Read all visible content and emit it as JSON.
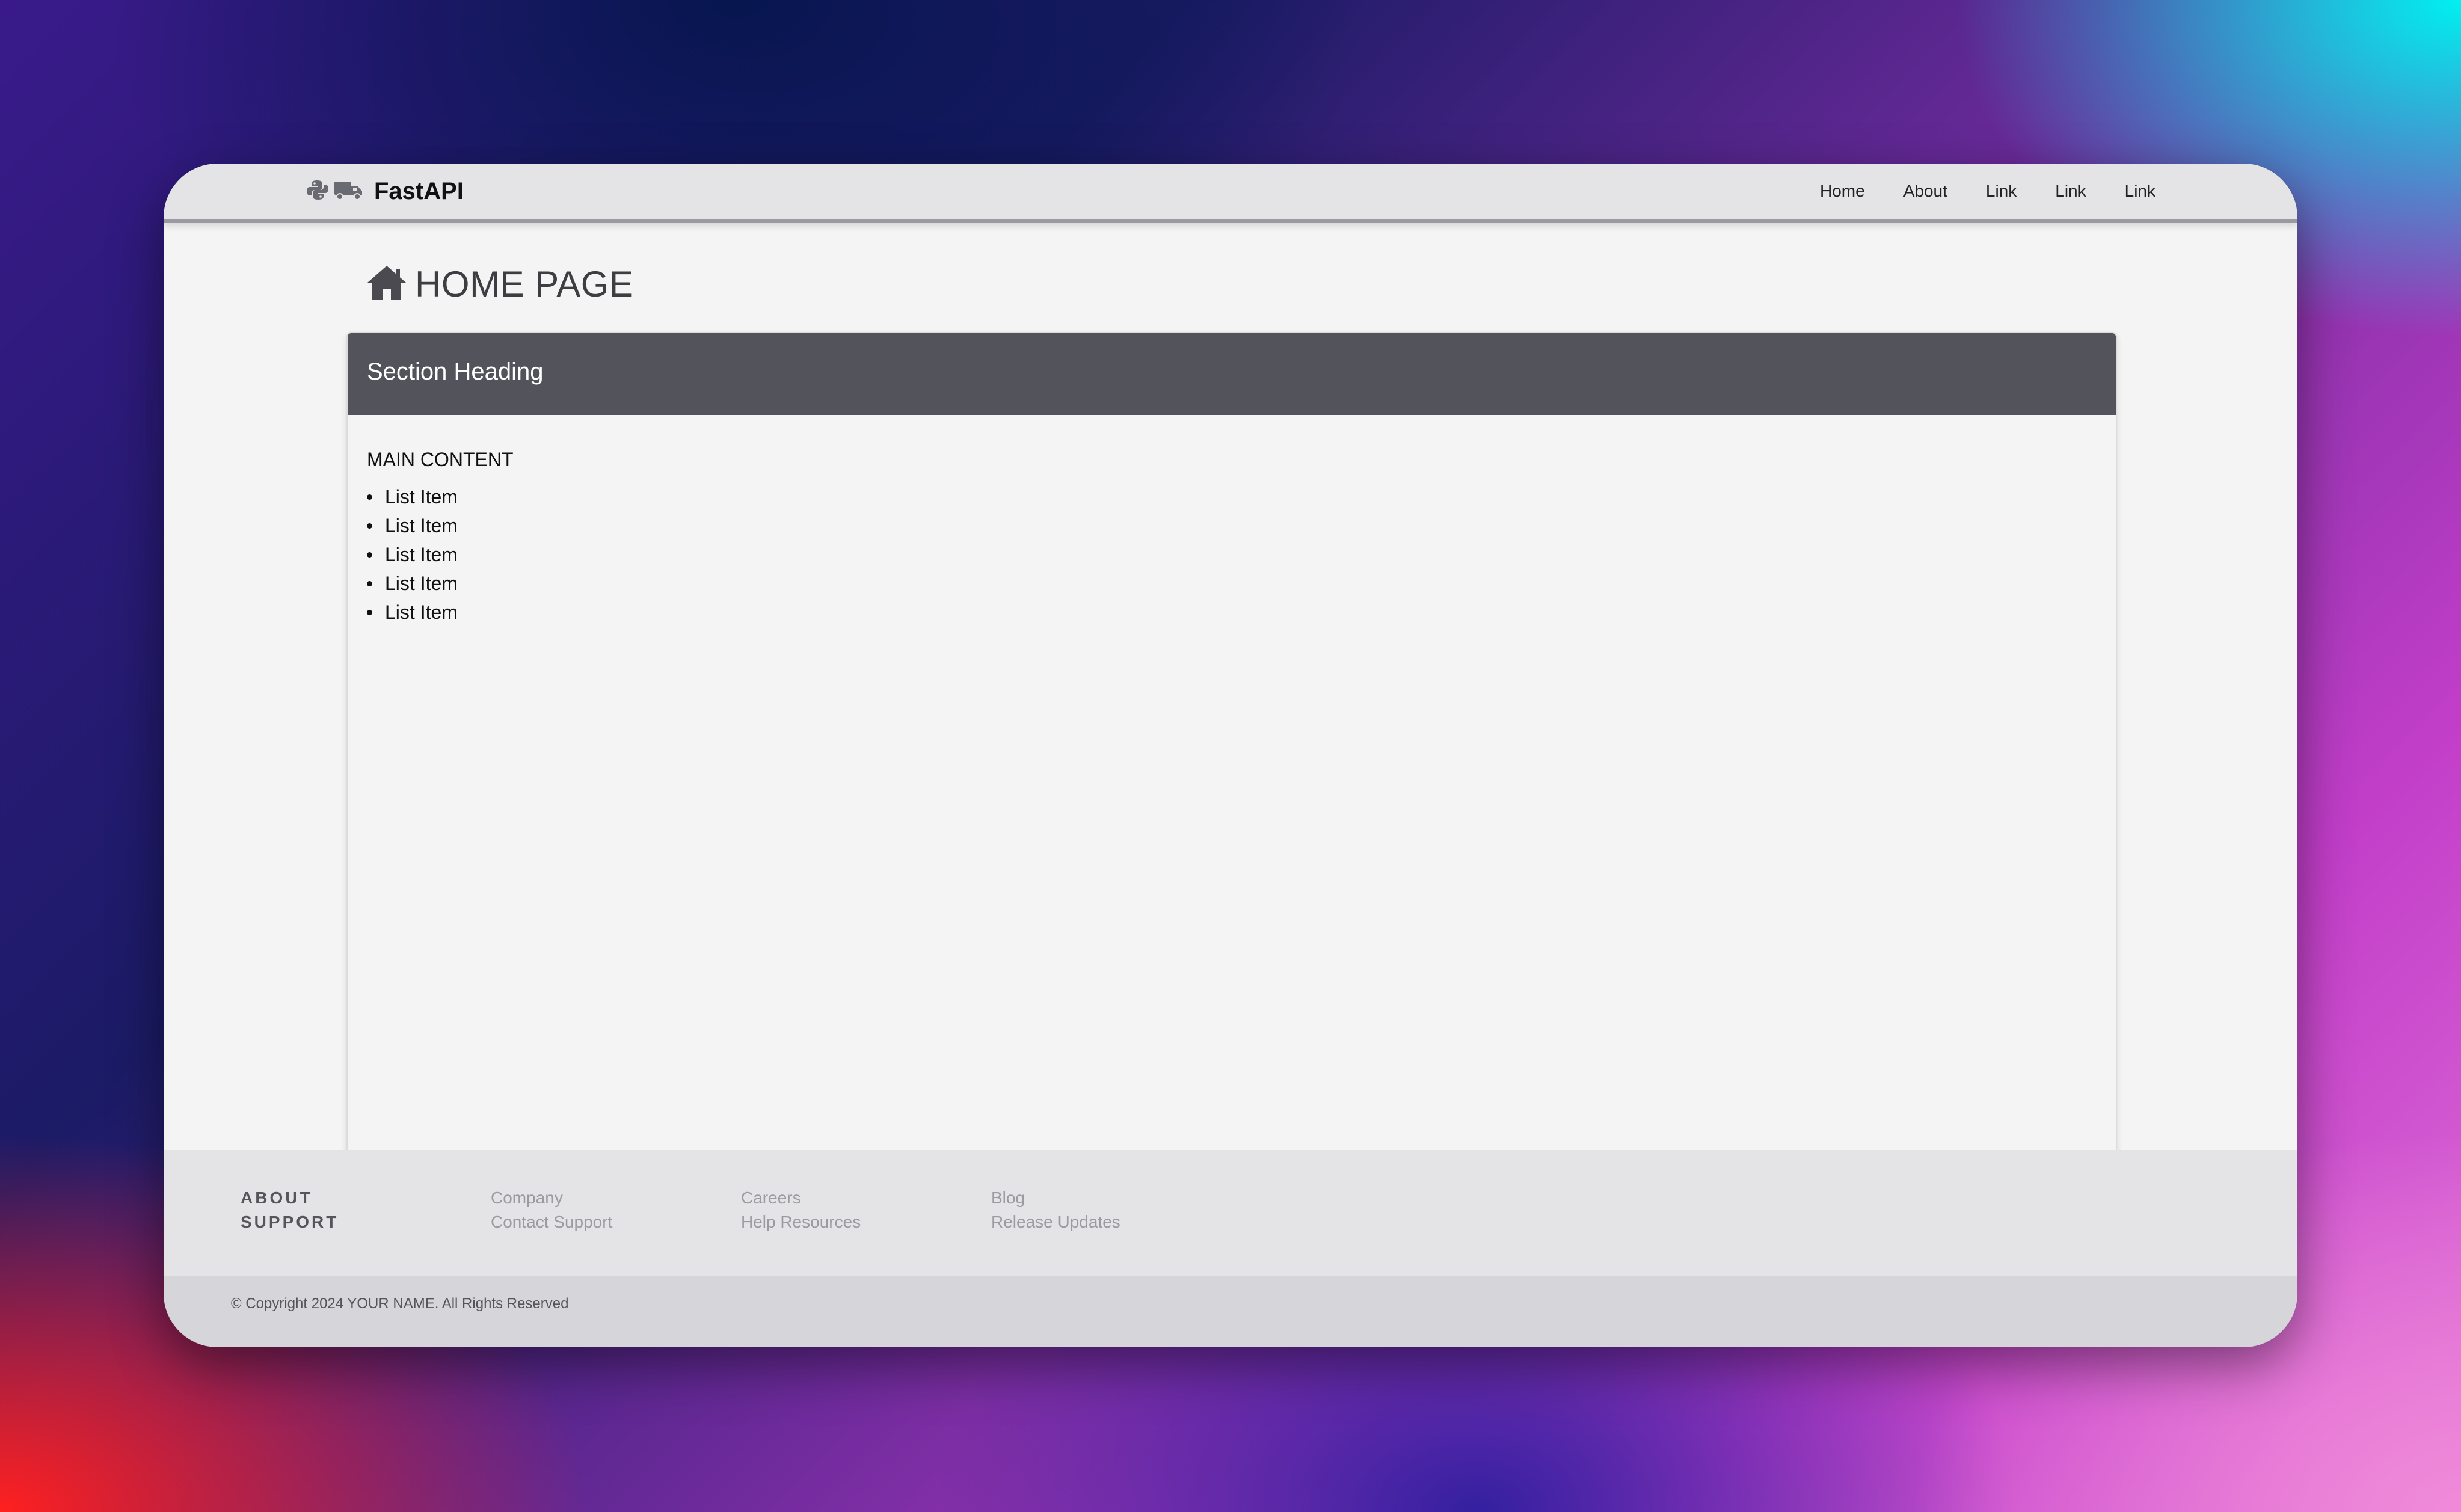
{
  "navbar": {
    "brand": "FastAPI",
    "brand_icons": [
      "python-icon",
      "truck-icon"
    ],
    "links": [
      "Home",
      "About",
      "Link",
      "Link",
      "Link"
    ]
  },
  "page": {
    "heading_icon": "home-icon",
    "heading": "HOME PAGE"
  },
  "card": {
    "header": "Section Heading",
    "main_label": "MAIN CONTENT",
    "items": [
      "List Item",
      "List Item",
      "List Item",
      "List Item",
      "List Item"
    ]
  },
  "footer": {
    "columns": [
      [
        "ABOUT",
        "SUPPORT"
      ],
      [
        "Company",
        "Contact Support"
      ],
      [
        "Careers",
        "Help Resources"
      ],
      [
        "Blog",
        "Release Updates"
      ]
    ],
    "copyright": "© Copyright 2024 YOUR NAME. All Rights Reserved"
  },
  "colors": {
    "navbar_bg": "#e4e4e6",
    "card_header_bg": "#53535b",
    "page_bg": "#f4f4f4",
    "footer_bg": "#e4e4e6",
    "copyright_bg": "#d6d6da"
  }
}
